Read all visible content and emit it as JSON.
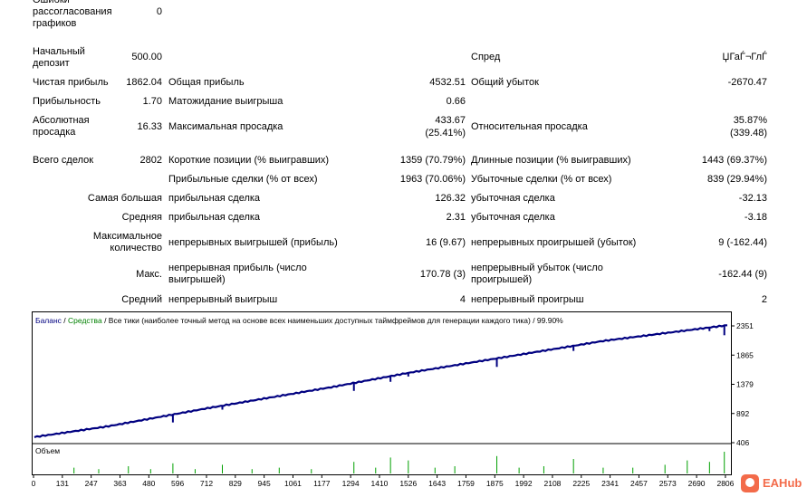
{
  "report": {
    "errors_label": "Ошибки рассогласования графиков",
    "errors_value": "0",
    "initial_deposit_label": "Начальный депозит",
    "initial_deposit_value": "500.00",
    "spread_label": "Спред",
    "spread_value": "ЏГаЃ¬ГлЃ",
    "net_profit_label": "Чистая прибыль",
    "net_profit_value": "1862.04",
    "gross_profit_label": "Общая прибыль",
    "gross_profit_value": "4532.51",
    "gross_loss_label": "Общий убыток",
    "gross_loss_value": "-2670.47",
    "profit_factor_label": "Прибыльность",
    "profit_factor_value": "1.70",
    "expected_payoff_label": "Матожидание выигрыша",
    "expected_payoff_value": "0.66",
    "abs_drawdown_label": "Абсолютная просадка",
    "abs_drawdown_value": "16.33",
    "max_drawdown_label": "Максимальная просадка",
    "max_drawdown_value_1": "433.67",
    "max_drawdown_value_2": "(25.41%)",
    "rel_drawdown_label": "Относительная просадка",
    "rel_drawdown_value_1": "35.87%",
    "rel_drawdown_value_2": "(339.48)",
    "total_trades_label": "Всего сделок",
    "total_trades_value": "2802",
    "short_label": "Короткие позиции (% выигравших)",
    "short_value": "1359 (70.79%)",
    "long_label": "Длинные позиции (% выигравших)",
    "long_value": "1443 (69.37%)",
    "profit_trades_label": "Прибыльные сделки (% от всех)",
    "profit_trades_value": "1963 (70.06%)",
    "loss_trades_label": "Убыточные сделки (% от всех)",
    "loss_trades_value": "839 (29.94%)",
    "largest_label": "Самая большая",
    "largest_profit_label": "прибыльная сделка",
    "largest_profit_value": "126.32",
    "largest_loss_label": "убыточная сделка",
    "largest_loss_value": "-32.13",
    "average_label": "Средняя",
    "average_profit_label": "прибыльная сделка",
    "average_profit_value": "2.31",
    "average_loss_label": "убыточная сделка",
    "average_loss_value": "-3.18",
    "max_count_label": "Максимальное количество",
    "max_cons_wins_label": "непрерывных выигрышей (прибыль)",
    "max_cons_wins_value": "16 (9.67)",
    "max_cons_losses_label": "непрерывных проигрышей (убыток)",
    "max_cons_losses_value": "9 (-162.44)",
    "max_label": "Макс.",
    "max_cons_profit_label": "непрерывная прибыль (число выигрышей)",
    "max_cons_profit_value": "170.78 (3)",
    "max_cons_loss_label": "непрерывный убыток (число проигрышей)",
    "max_cons_loss_value": "-162.44 (9)",
    "avg_label": "Средний",
    "avg_cons_wins_label": "непрерывный выигрыш",
    "avg_cons_wins_value": "4",
    "avg_cons_losses_label": "непрерывный проигрыш",
    "avg_cons_losses_value": "2"
  },
  "chart_data": {
    "type": "line",
    "legend_balance": "Баланс",
    "legend_sep": " / ",
    "legend_equity": "Средства",
    "legend_rest": " / Все тики (наиболее точный метод на основе всех наименьших доступных таймфреймов для генерации каждого тика) / 99.90%",
    "volume_label": "Объем",
    "x_ticks": [
      "0",
      "131",
      "247",
      "363",
      "480",
      "596",
      "712",
      "829",
      "945",
      "1061",
      "1177",
      "1294",
      "1410",
      "1526",
      "1643",
      "1759",
      "1875",
      "1992",
      "2108",
      "2225",
      "2341",
      "2457",
      "2573",
      "2690",
      "2806"
    ],
    "y_ticks": [
      "2351",
      "1865",
      "1379",
      "892",
      "406"
    ],
    "ylim": [
      406,
      2351
    ],
    "xlim": [
      0,
      2802
    ],
    "series": [
      {
        "name": "Баланс",
        "color": "#000080",
        "x": [
          0,
          300,
          700,
          1200,
          1500,
          1900,
          2300,
          2802
        ],
        "values": [
          500,
          680,
          980,
          1330,
          1560,
          1830,
          2100,
          2362
        ]
      }
    ],
    "equity_dips": [
      {
        "x": 560,
        "y": 250
      },
      {
        "x": 760,
        "y": 215
      },
      {
        "x": 1292,
        "y": 250
      },
      {
        "x": 1440,
        "y": 230
      },
      {
        "x": 1512,
        "y": 210
      },
      {
        "x": 1870,
        "y": 255
      },
      {
        "x": 2180,
        "y": 225
      },
      {
        "x": 2730,
        "y": 190
      },
      {
        "x": 2790,
        "y": 265
      }
    ],
    "volume_spikes": [
      {
        "x": 160,
        "v": 0.2
      },
      {
        "x": 260,
        "v": 0.15
      },
      {
        "x": 380,
        "v": 0.25
      },
      {
        "x": 470,
        "v": 0.15
      },
      {
        "x": 560,
        "v": 0.35
      },
      {
        "x": 650,
        "v": 0.15
      },
      {
        "x": 760,
        "v": 0.3
      },
      {
        "x": 880,
        "v": 0.15
      },
      {
        "x": 990,
        "v": 0.2
      },
      {
        "x": 1120,
        "v": 0.15
      },
      {
        "x": 1292,
        "v": 0.4
      },
      {
        "x": 1380,
        "v": 0.2
      },
      {
        "x": 1440,
        "v": 0.55
      },
      {
        "x": 1512,
        "v": 0.45
      },
      {
        "x": 1620,
        "v": 0.2
      },
      {
        "x": 1700,
        "v": 0.25
      },
      {
        "x": 1870,
        "v": 0.6
      },
      {
        "x": 1960,
        "v": 0.2
      },
      {
        "x": 2060,
        "v": 0.25
      },
      {
        "x": 2180,
        "v": 0.5
      },
      {
        "x": 2300,
        "v": 0.2
      },
      {
        "x": 2420,
        "v": 0.2
      },
      {
        "x": 2550,
        "v": 0.3
      },
      {
        "x": 2640,
        "v": 0.45
      },
      {
        "x": 2730,
        "v": 0.4
      },
      {
        "x": 2790,
        "v": 0.75
      }
    ]
  }
}
